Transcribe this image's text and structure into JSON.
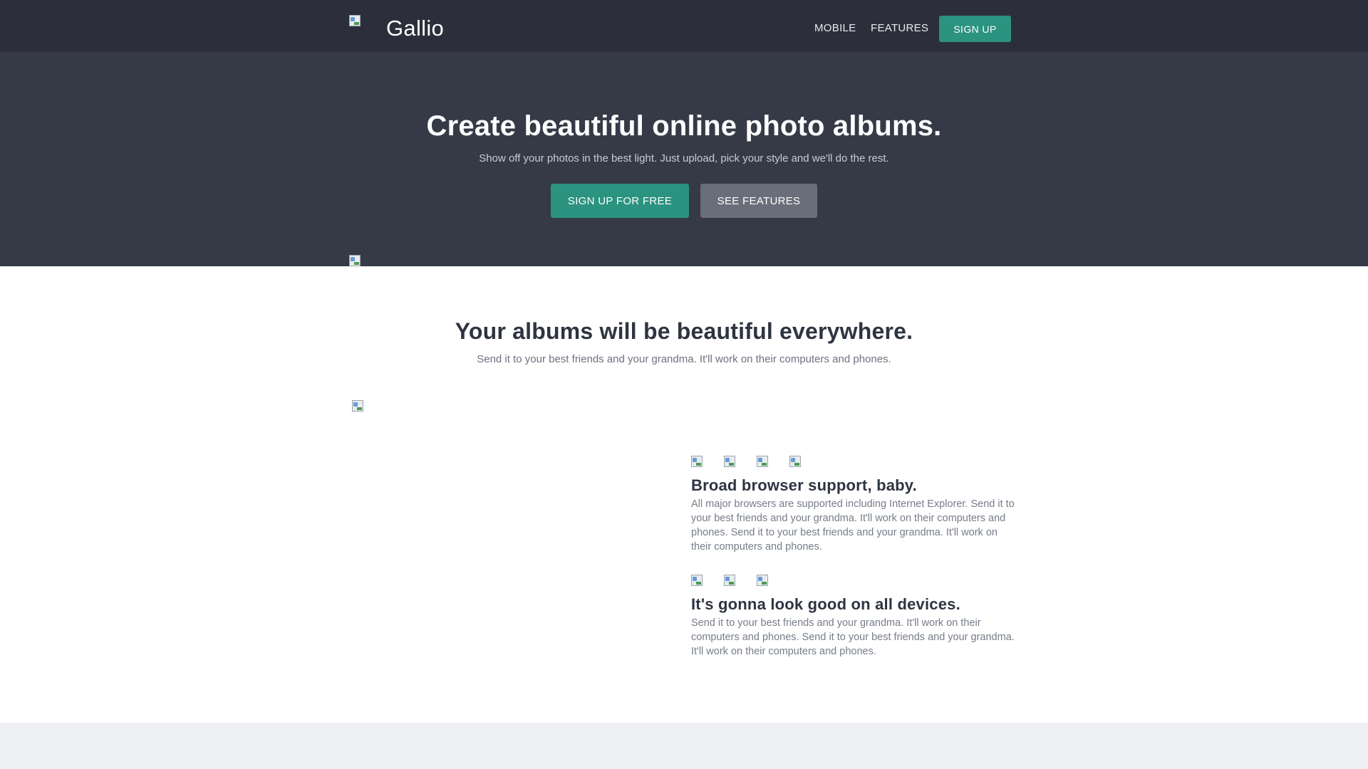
{
  "nav": {
    "brand": "Gallio",
    "links": [
      "MOBILE",
      "FEATURES"
    ],
    "signup": "SIGN UP"
  },
  "hero": {
    "title": "Create beautiful online photo albums.",
    "subtitle": "Show off your photos in the best light.  Just upload, pick your style and we'll do the rest.",
    "primary_button": "SIGN UP FOR FREE",
    "secondary_button": "SEE FEATURES"
  },
  "section": {
    "title": "Your albums will be beautiful everywhere.",
    "subtitle": "Send it to your best friends and your grandma. It'll work on their computers and phones."
  },
  "features": [
    {
      "title": "Broad browser support, baby.",
      "text": "All major browsers are supported including Internet Explorer. Send it to your best friends and your grandma. It'll work on their computers and phones. Send it to your best friends and your grandma. It'll work on their computers and phones.",
      "icons": [
        "browser-icon",
        "browser-icon",
        "browser-icon",
        "browser-icon"
      ]
    },
    {
      "title": "It's gonna look good on all devices.",
      "text": "Send it to your best friends and your grandma. It'll work on their computers and phones. Send it to your best friends and your grandma. It'll work on their computers and phones.",
      "icons": [
        "device-icon",
        "device-icon",
        "device-icon"
      ]
    }
  ],
  "colors": {
    "nav_bg": "#2c2f3b",
    "hero_bg": "#363a47",
    "accent": "#2b9380",
    "secondary_button": "#6a6e7a",
    "footer_bg": "#eff0f3"
  }
}
